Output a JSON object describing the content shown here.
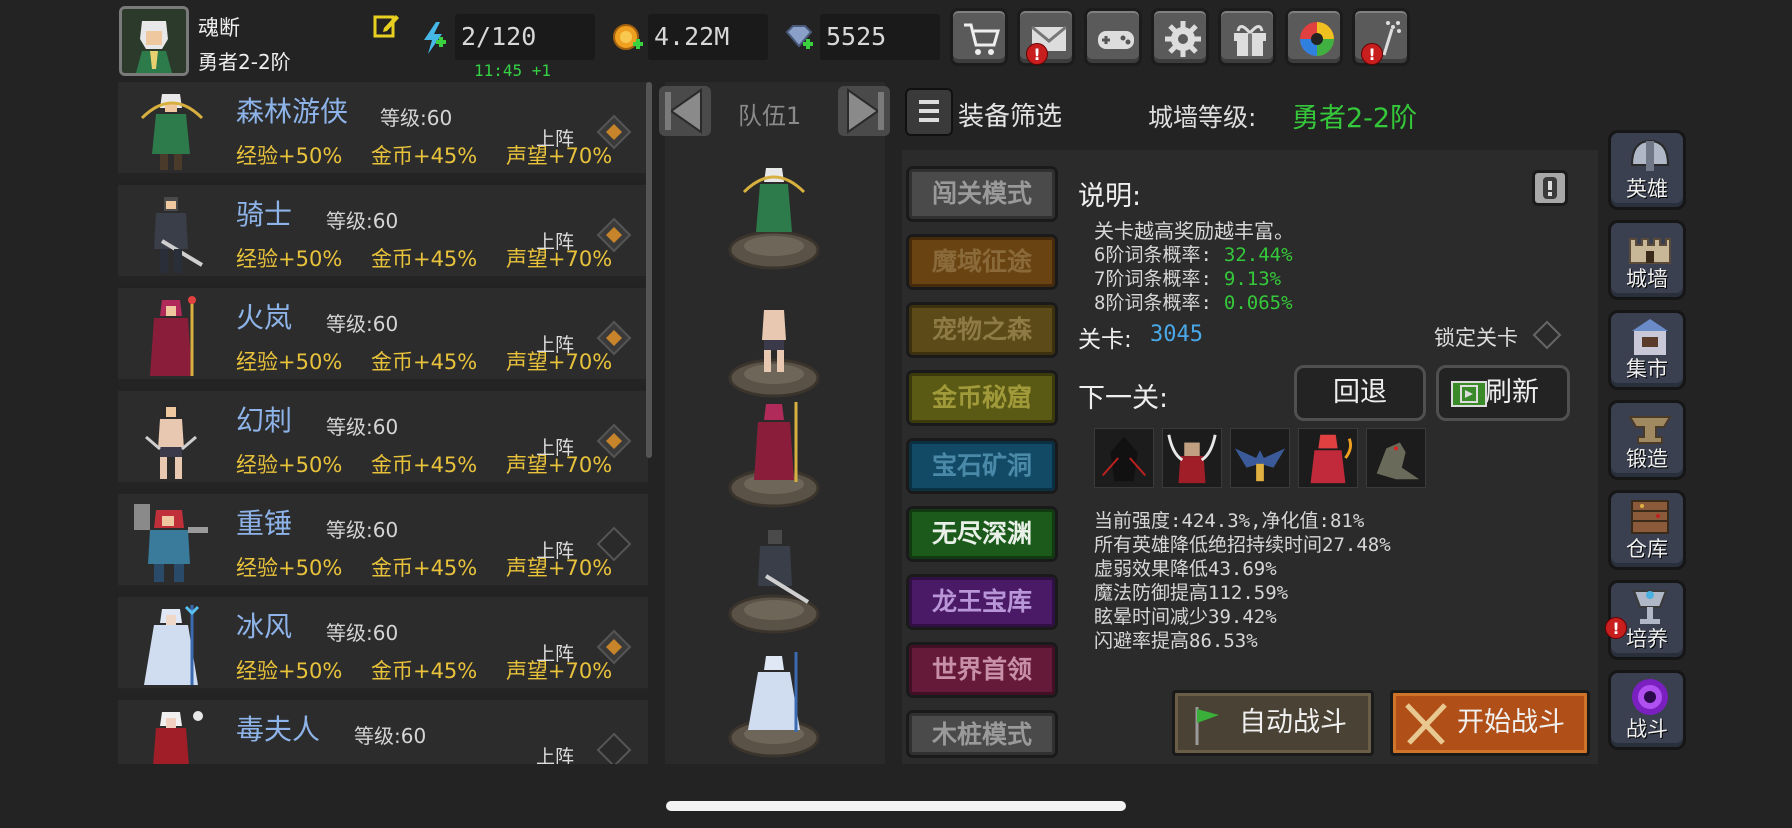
{
  "player": {
    "name": "魂断",
    "rank": "勇者2-2阶"
  },
  "resources": {
    "energy": "2/120",
    "energy_timer": "11:45 +1",
    "gold": "4.22M",
    "gems": "5525"
  },
  "top_buttons": [
    {
      "icon": "cart-icon",
      "alert": false
    },
    {
      "icon": "mail-icon",
      "alert": true
    },
    {
      "icon": "gamepad-icon",
      "alert": false
    },
    {
      "icon": "gear-icon",
      "alert": false
    },
    {
      "icon": "gift-icon",
      "alert": false
    },
    {
      "icon": "color-wheel-icon",
      "alert": false
    },
    {
      "icon": "firework-icon",
      "alert": true
    }
  ],
  "heroes": [
    {
      "name": "森林游侠",
      "level": "等级:60",
      "exp": "经验+50%",
      "gold": "金币+45%",
      "fame": "声望+70%",
      "deploy": "上阵",
      "deployed": true
    },
    {
      "name": "骑士",
      "level": "等级:60",
      "exp": "经验+50%",
      "gold": "金币+45%",
      "fame": "声望+70%",
      "deploy": "上阵",
      "deployed": true
    },
    {
      "name": "火岚",
      "level": "等级:60",
      "exp": "经验+50%",
      "gold": "金币+45%",
      "fame": "声望+70%",
      "deploy": "上阵",
      "deployed": true
    },
    {
      "name": "幻刺",
      "level": "等级:60",
      "exp": "经验+50%",
      "gold": "金币+45%",
      "fame": "声望+70%",
      "deploy": "上阵",
      "deployed": true
    },
    {
      "name": "重锤",
      "level": "等级:60",
      "exp": "经验+50%",
      "gold": "金币+45%",
      "fame": "声望+70%",
      "deploy": "上阵",
      "deployed": false
    },
    {
      "name": "冰风",
      "level": "等级:60",
      "exp": "经验+50%",
      "gold": "金币+45%",
      "fame": "声望+70%",
      "deploy": "上阵",
      "deployed": true
    },
    {
      "name": "毒夫人",
      "level": "等级:60",
      "exp": "",
      "gold": "",
      "fame": "",
      "deploy": "上阵",
      "deployed": false
    }
  ],
  "team": {
    "label": "队伍1"
  },
  "filter": {
    "label": "装备筛选"
  },
  "wall": {
    "label": "城墙等级:",
    "value": "勇者2-2阶"
  },
  "modes": [
    {
      "label": "闯关模式",
      "bg": "#4a4a4a",
      "color": "#9a9a9a"
    },
    {
      "label": "魔域征途",
      "bg": "#6a4312",
      "color": "#8a6a3a"
    },
    {
      "label": "宠物之森",
      "bg": "#5c4a18",
      "color": "#8e7a45"
    },
    {
      "label": "金币秘窟",
      "bg": "#5a5a14",
      "color": "#a09a3a"
    },
    {
      "label": "宝石矿洞",
      "bg": "#124a66",
      "color": "#4a8aa8"
    },
    {
      "label": "无尽深渊",
      "bg": "#1c5a1c",
      "color": "#e8f0e8"
    },
    {
      "label": "龙王宝库",
      "bg": "#4a1a66",
      "color": "#b896d8"
    },
    {
      "label": "世界首领",
      "bg": "#661a3a",
      "color": "#c890a8"
    },
    {
      "label": "木桩模式",
      "bg": "#4a4a4a",
      "color": "#9a9a9a"
    }
  ],
  "info": {
    "title": "说明:",
    "text": "关卡越高奖励越丰富。",
    "probs": [
      {
        "label": "6阶词条概率:",
        "value": "32.44%"
      },
      {
        "label": "7阶词条概率:",
        "value": "9.13%"
      },
      {
        "label": "8阶词条概率:",
        "value": "0.065%"
      }
    ],
    "stage_label": "关卡:",
    "stage_value": "3045",
    "lock_label": "锁定关卡",
    "next_label": "下一关:",
    "back_button": "回退",
    "refresh_button": "刷新",
    "stats": [
      "当前强度:424.3%,净化值:81%",
      "所有英雄降低绝招持续时间27.48%",
      "虚弱效果降低43.69%",
      "魔法防御提高112.59%",
      "眩晕时间减少39.42%",
      "闪避率提高86.53%"
    ]
  },
  "battle": {
    "auto": "自动战斗",
    "start": "开始战斗"
  },
  "side_menu": [
    {
      "label": "英雄",
      "icon": "helmet-icon",
      "alert": false
    },
    {
      "label": "城墙",
      "icon": "castle-icon",
      "alert": false
    },
    {
      "label": "集市",
      "icon": "market-icon",
      "alert": false
    },
    {
      "label": "锻造",
      "icon": "anvil-icon",
      "alert": false
    },
    {
      "label": "仓库",
      "icon": "warehouse-icon",
      "alert": false
    },
    {
      "label": "培养",
      "icon": "chalice-icon",
      "alert": true
    },
    {
      "label": "战斗",
      "icon": "portal-icon",
      "alert": false
    }
  ]
}
